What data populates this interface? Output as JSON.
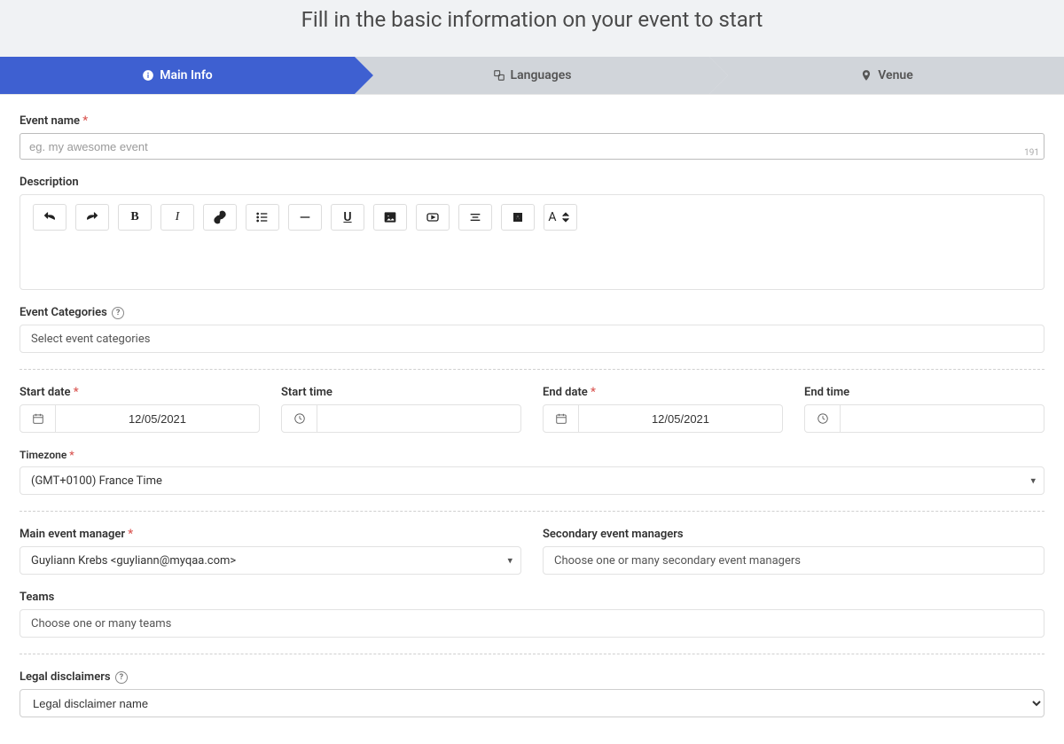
{
  "heading": "Fill in the basic information on your event to start",
  "steps": {
    "mainInfo": "Main Info",
    "languages": "Languages",
    "venue": "Venue"
  },
  "eventName": {
    "label": "Event name",
    "placeholder": "eg. my awesome event",
    "counter": "191"
  },
  "description": {
    "label": "Description"
  },
  "categories": {
    "label": "Event Categories",
    "placeholder": "Select event categories"
  },
  "dates": {
    "startDateLabel": "Start date",
    "startTimeLabel": "Start time",
    "endDateLabel": "End date",
    "endTimeLabel": "End time",
    "startDateValue": "12/05/2021",
    "endDateValue": "12/05/2021"
  },
  "timezone": {
    "label": "Timezone",
    "value": "(GMT+0100) France Time"
  },
  "managers": {
    "mainLabel": "Main event manager",
    "mainValue": "Guyliann Krebs <guyliann@myqaa.com>",
    "secondaryLabel": "Secondary event managers",
    "secondaryPlaceholder": "Choose one or many secondary event managers"
  },
  "teams": {
    "label": "Teams",
    "placeholder": "Choose one or many teams"
  },
  "legal": {
    "label": "Legal disclaimers",
    "value": "Legal disclaimer name"
  },
  "icons": {
    "info": "info-icon",
    "languages": "languages-icon",
    "venue": "pin-icon",
    "calendar": "calendar-icon",
    "clock": "clock-icon"
  }
}
